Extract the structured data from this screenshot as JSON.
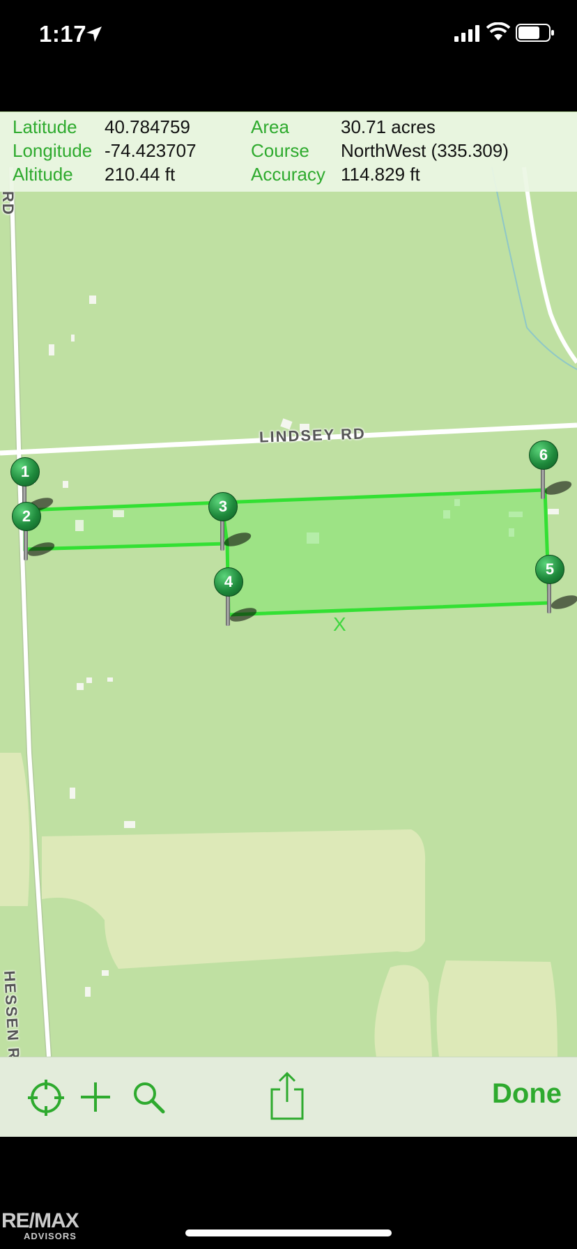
{
  "status_bar": {
    "time": "1:17"
  },
  "info": {
    "latitude_label": "Latitude",
    "latitude_value": "40.784759",
    "longitude_label": "Longitude",
    "longitude_value": "-74.423707",
    "altitude_label": "Altitude",
    "altitude_value": "210.44 ft",
    "area_label": "Area",
    "area_value": "30.71 acres",
    "course_label": "Course",
    "course_value": "NorthWest (335.309)",
    "accuracy_label": "Accuracy",
    "accuracy_value": "114.829 ft"
  },
  "map": {
    "road_labels": {
      "lindsey": "LINDSEY RD",
      "hessen": "HESSEN RD",
      "rd_top": "RD"
    },
    "centroid_marker": "X",
    "pins": [
      "1",
      "2",
      "3",
      "4",
      "5",
      "6"
    ],
    "polygon_color": "#33e033"
  },
  "toolbar": {
    "done_label": "Done"
  },
  "branding": {
    "line1": "RE/MAX",
    "line2": "ADVISORS"
  },
  "colors": {
    "accent": "#2eaa2e",
    "map_bg": "#bfe0a2"
  }
}
